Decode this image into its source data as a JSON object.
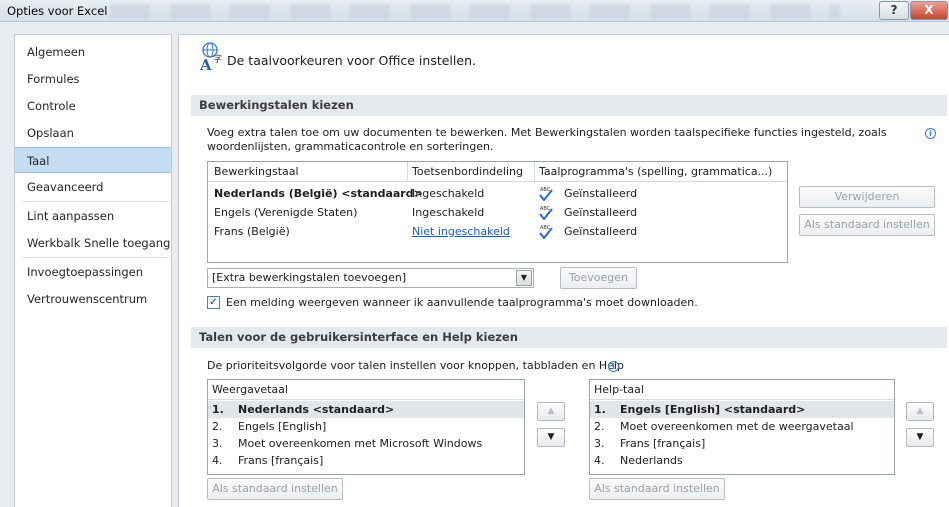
{
  "window": {
    "title": "Opties voor Excel",
    "help_label": "?",
    "close_label": "X"
  },
  "sidebar": {
    "items": [
      {
        "label": "Algemeen"
      },
      {
        "label": "Formules"
      },
      {
        "label": "Controle"
      },
      {
        "label": "Opslaan"
      },
      {
        "label": "Taal"
      },
      {
        "label": "Geavanceerd"
      },
      {
        "label": "Lint aanpassen"
      },
      {
        "label": "Werkbalk Snelle toegang"
      },
      {
        "label": "Invoegtoepassingen"
      },
      {
        "label": "Vertrouwenscentrum"
      }
    ],
    "active": "Taal"
  },
  "main": {
    "heading": "De taalvoorkeuren voor Office instellen.",
    "editing": {
      "section_title": "Bewerkingstalen kiezen",
      "description_line1": "Voeg extra talen toe om uw documenten te bewerken. Met Bewerkingstalen worden taalspecifieke functies ingesteld, zoals",
      "description_line2": "woordenlijsten, grammaticacontrole en sorteringen.",
      "columns": [
        "Bewerkingstaal",
        "Toetsenbordindeling",
        "Taalprogramma's (spelling, grammatica...)"
      ],
      "rows": [
        {
          "language": "Nederlands (België) <standaard>",
          "keyboard": "Ingeschakeld",
          "proofing": "Geïnstalleerd"
        },
        {
          "language": "Engels (Verenigde Staten)",
          "keyboard": "Ingeschakeld",
          "proofing": "Geïnstalleerd"
        },
        {
          "language": "Frans (België)",
          "keyboard": "Niet ingeschakeld",
          "proofing": "Geïnstalleerd"
        }
      ],
      "remove_button": "Verwijderen",
      "set_default_button": "Als standaard instellen",
      "add_combo_value": "[Extra bewerkingstalen toevoegen]",
      "add_button": "Toevoegen",
      "notify_checkbox_label": "Een melding weergeven wanneer ik aanvullende taalprogramma's moet downloaden.",
      "notify_checked": true
    },
    "ui": {
      "section_title": "Talen voor de gebruikersinterface en Help kiezen",
      "description": "De prioriteitsvolgorde voor talen instellen voor knoppen, tabbladen en Help",
      "display": {
        "header": "Weergavetaal",
        "items": [
          {
            "num": "1.",
            "label": "Nederlands <standaard>"
          },
          {
            "num": "2.",
            "label": "Engels [English]"
          },
          {
            "num": "3.",
            "label": "Moet overeenkomen met Microsoft Windows"
          },
          {
            "num": "4.",
            "label": "Frans [français]"
          }
        ],
        "set_default_button": "Als standaard instellen"
      },
      "help": {
        "header": "Help-taal",
        "items": [
          {
            "num": "1.",
            "label": "Engels [English] <standaard>"
          },
          {
            "num": "2.",
            "label": "Moet overeenkomen met de weergavetaal"
          },
          {
            "num": "3.",
            "label": "Frans [français]"
          },
          {
            "num": "4.",
            "label": "Nederlands"
          }
        ],
        "set_default_button": "Als standaard instellen"
      }
    }
  },
  "colors": {
    "accent": "#1a5fb4",
    "selection": "#c5ddf2",
    "section_bg": "#e5e9ee"
  }
}
